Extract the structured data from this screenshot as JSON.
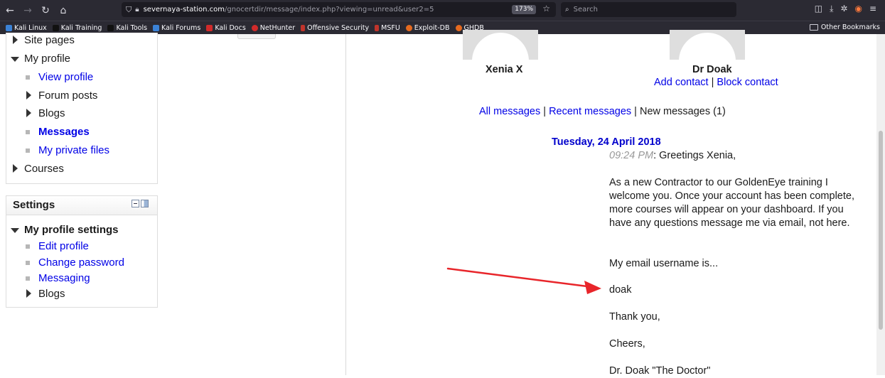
{
  "browser": {
    "url_host": "severnaya-station.com",
    "url_path": "/gnocertdir/message/index.php?viewing=unread&user2=5",
    "zoom": "173%",
    "search_placeholder": "Search",
    "bookmarks": [
      {
        "label": "Kali Linux",
        "color": "#3b82d6"
      },
      {
        "label": "Kali Training",
        "color": "#2c2c2c"
      },
      {
        "label": "Kali Tools",
        "color": "#2c2c2c"
      },
      {
        "label": "Kali Forums",
        "color": "#3b82d6"
      },
      {
        "label": "Kali Docs",
        "color": "#d12a2a"
      },
      {
        "label": "NetHunter",
        "color": "#d12a2a"
      },
      {
        "label": "Offensive Security",
        "color": "#c0342b"
      },
      {
        "label": "MSFU",
        "color": "#c0342b"
      },
      {
        "label": "Exploit-DB",
        "color": "#e66a1f"
      },
      {
        "label": "GHDB",
        "color": "#e66a1f"
      }
    ],
    "other_bookmarks": "Other Bookmarks"
  },
  "navigation": {
    "site_pages": "Site pages",
    "my_profile": "My profile",
    "view_profile": "View profile",
    "forum_posts": "Forum posts",
    "blogs": "Blogs",
    "messages": "Messages",
    "my_private_files": "My private files",
    "courses": "Courses"
  },
  "settings": {
    "title": "Settings",
    "my_profile_settings": "My profile settings",
    "edit_profile": "Edit profile",
    "change_password": "Change password",
    "messaging": "Messaging",
    "blogs": "Blogs"
  },
  "contacts": {
    "user1": "Xenia X",
    "user2": "Dr Doak",
    "add_contact": "Add contact",
    "separator": "|",
    "block_contact": "Block contact"
  },
  "message_tabs": {
    "all": "All messages",
    "recent": "Recent messages",
    "new": "New messages (1)"
  },
  "message": {
    "date": "Tuesday, 24 April 2018",
    "time": "09:24 PM",
    "greeting": ": Greetings Xenia,",
    "paragraph": "As a new Contractor to our GoldenEye training I welcome you. Once your account has been complete, more courses will appear on your dashboard. If you have any questions message me via email, not here.",
    "username_line": "My email username is...",
    "username": "doak",
    "thanks": "Thank you,",
    "cheers": "Cheers,",
    "signature": "Dr. Doak \"The Doctor\""
  },
  "annotation": {
    "arrow_color": "#e8252a"
  }
}
